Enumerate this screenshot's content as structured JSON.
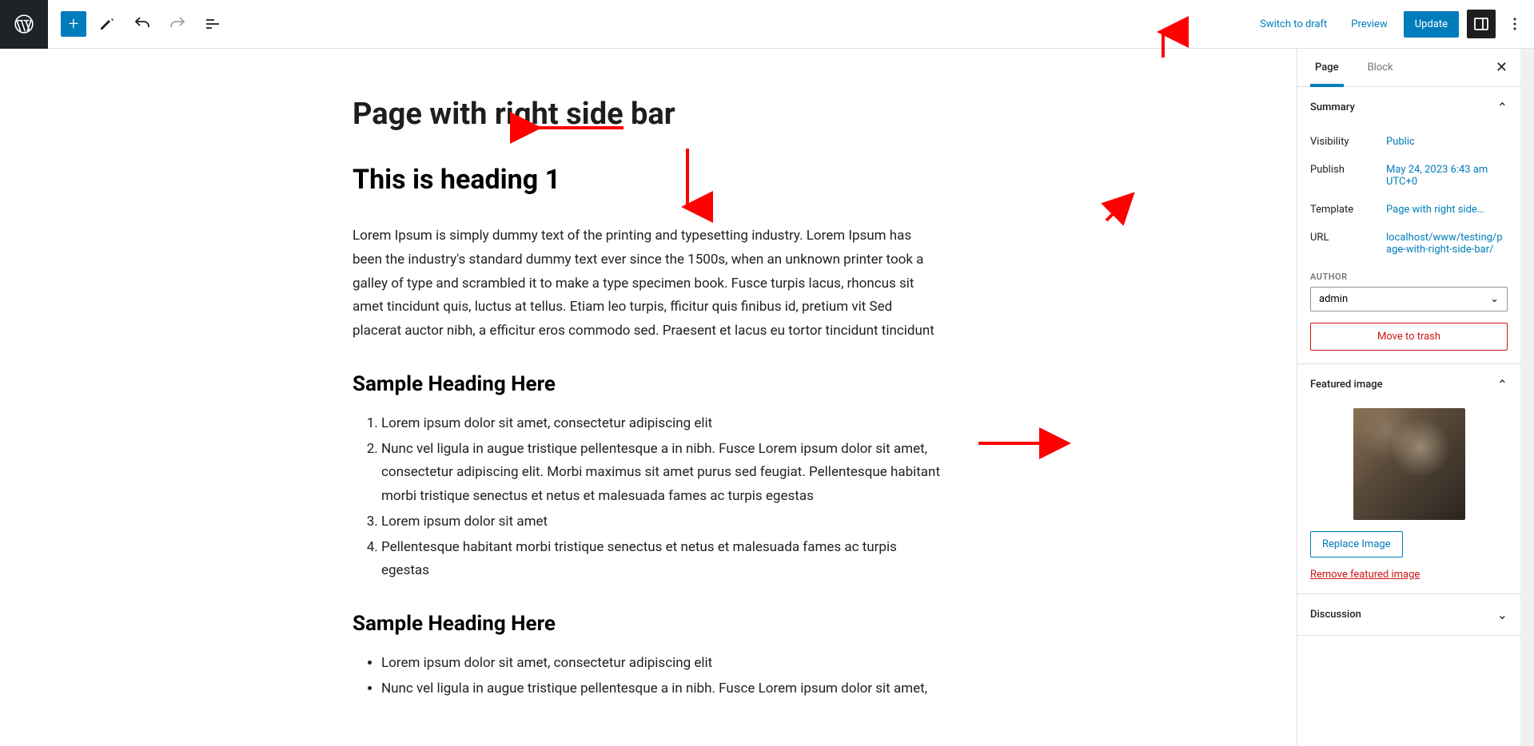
{
  "toolbar": {
    "switch_to_draft": "Switch to draft",
    "preview": "Preview",
    "update": "Update"
  },
  "tabs": {
    "page": "Page",
    "block": "Block"
  },
  "summary": {
    "title": "Summary",
    "visibility_label": "Visibility",
    "visibility_value": "Public",
    "publish_label": "Publish",
    "publish_value": "May 24, 2023 6:43 am UTC+0",
    "template_label": "Template",
    "template_value": "Page with right side…",
    "url_label": "URL",
    "url_value": "localhost/www/testing/page-with-right-side-bar/",
    "author_label": "AUTHOR",
    "author_value": "admin",
    "trash": "Move to trash"
  },
  "featured": {
    "title": "Featured image",
    "replace": "Replace Image",
    "remove": "Remove featured image"
  },
  "discussion": {
    "title": "Discussion"
  },
  "content": {
    "title": "Page with right side bar",
    "h1": "This is heading 1",
    "p1": "Lorem Ipsum is simply dummy text of the printing and typesetting industry. Lorem Ipsum has been the industry's standard dummy text ever since the 1500s, when an unknown printer took a galley of type and scrambled it to make a type specimen book. Fusce turpis lacus, rhoncus sit amet tincidunt quis, luctus at tellus. Etiam leo turpis, fficitur quis finibus id, pretium vit Sed placerat auctor nibh, a efficitur eros commodo sed. Praesent et lacus eu tortor tincidunt tincidunt",
    "h2a": "Sample Heading Here",
    "list1": [
      "Lorem ipsum dolor sit amet, consectetur adipiscing elit",
      "Nunc vel ligula in augue tristique pellentesque a in nibh. Fusce Lorem ipsum dolor sit amet, consectetur adipiscing elit. Morbi maximus sit amet purus sed feugiat. Pellentesque habitant morbi tristique senectus et netus et malesuada fames ac turpis egestas",
      "Lorem ipsum dolor sit amet",
      "Pellentesque habitant morbi tristique senectus et netus et malesuada fames ac turpis egestas"
    ],
    "h2b": "Sample Heading Here",
    "list2": [
      "Lorem ipsum dolor sit amet, consectetur adipiscing elit",
      "Nunc vel ligula in augue tristique pellentesque a in nibh. Fusce Lorem ipsum dolor sit amet,"
    ]
  }
}
